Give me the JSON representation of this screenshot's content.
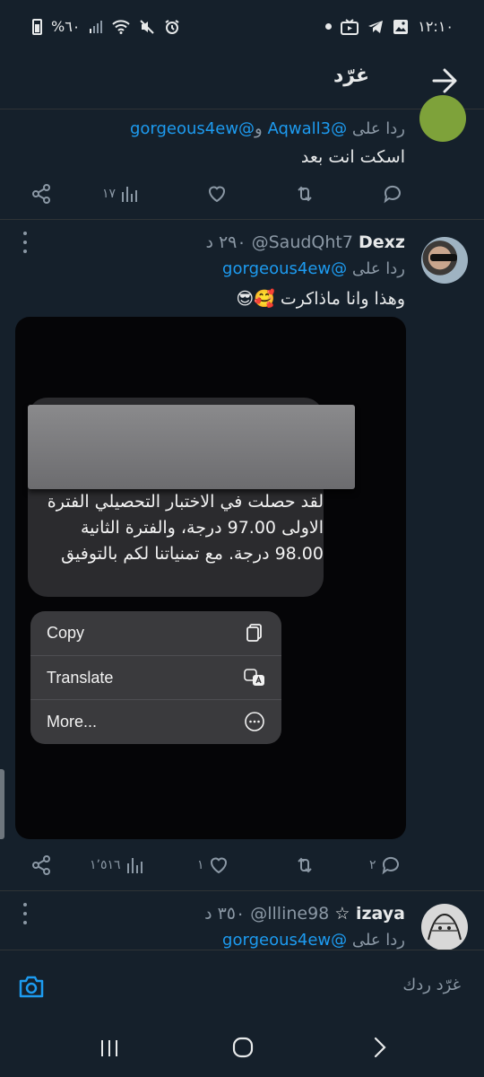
{
  "status": {
    "battery_text": "%٦٠",
    "time": "١٢:١٠"
  },
  "header": {
    "title": "غرّد"
  },
  "tweet1": {
    "reply_prefix": "ردا على",
    "reply_handle1": "@Aqwall3",
    "reply_and": "و",
    "reply_handle2": "@gorgeous4ew",
    "text": "اسكت انت بعد",
    "views": "١٧"
  },
  "tweet2": {
    "name": "Dexz",
    "handle": "@SaudQht7",
    "time": "٢٩٠ د",
    "reply_prefix": "ردا على",
    "reply_handle": "@gorgeous4ew",
    "text": "وهذا وانا ماذاكرت 🥰😎",
    "media": {
      "message_text": "لقد حصلت في الاختبار التحصيلي الفترة الاولى 97.00 درجة، والفترة الثانية  98.00 درجة. مع تمنياتنا لكم بالتوفيق",
      "menu": [
        "Copy",
        "Translate",
        "More..."
      ]
    },
    "views": "١٬٥١٦",
    "likes": "١",
    "replies": "٢"
  },
  "tweet3": {
    "name": "izaya ☆",
    "handle": "@llline98",
    "time": "٣٥٠ د",
    "reply_prefix": "ردا على",
    "reply_handle": "@gorgeous4ew"
  },
  "compose": {
    "placeholder": "غرّد ردك"
  },
  "colors": {
    "background": "#15202b",
    "accent": "#1d9bf0",
    "muted": "#8b98a5"
  }
}
